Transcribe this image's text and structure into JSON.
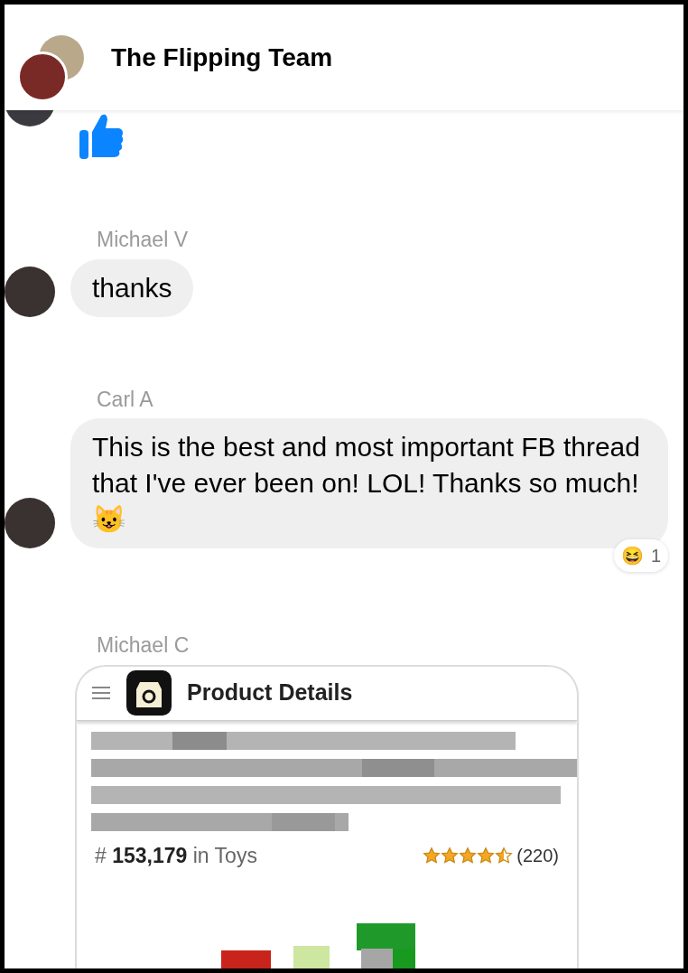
{
  "header": {
    "title": "The Flipping Team"
  },
  "messages": [
    {
      "kind": "like"
    },
    {
      "kind": "text",
      "sender": "Michael V",
      "text": "thanks"
    },
    {
      "kind": "text",
      "sender": "Carl A",
      "text": "This is the best and most important FB thread that I've ever been on! LOL!  Thanks so much! 😺",
      "reaction": {
        "emoji": "😆",
        "count": "1"
      }
    },
    {
      "kind": "product",
      "sender": "Michael C",
      "card": {
        "title": "Product Details",
        "rank_prefix": "#",
        "rank": "153,179",
        "rank_suffix": "in Toys",
        "stars": 4.5,
        "reviews": "(220)"
      }
    }
  ]
}
